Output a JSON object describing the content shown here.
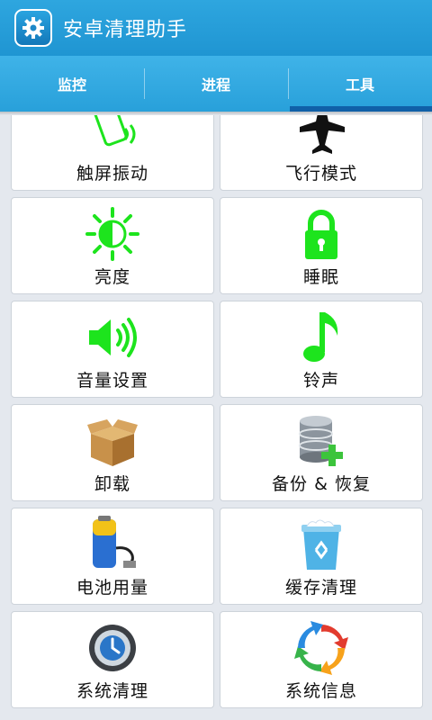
{
  "app": {
    "title": "安卓清理助手"
  },
  "tabs": [
    {
      "label": "监控"
    },
    {
      "label": "进程"
    },
    {
      "label": "工具"
    }
  ],
  "tools": [
    {
      "label": "触屏振动",
      "icon": "phone-vibrate-icon"
    },
    {
      "label": "飞行模式",
      "icon": "airplane-icon"
    },
    {
      "label": "亮度",
      "icon": "brightness-icon"
    },
    {
      "label": "睡眠",
      "icon": "lock-icon"
    },
    {
      "label": "音量设置",
      "icon": "speaker-icon"
    },
    {
      "label": "铃声",
      "icon": "music-note-icon"
    },
    {
      "label": "卸载",
      "icon": "box-icon"
    },
    {
      "label": "备份 & 恢复",
      "icon": "database-plus-icon"
    },
    {
      "label": "电池用量",
      "icon": "battery-icon"
    },
    {
      "label": "缓存清理",
      "icon": "recycle-bin-icon"
    },
    {
      "label": "系统清理",
      "icon": "clock-icon"
    },
    {
      "label": "系统信息",
      "icon": "refresh-icon"
    }
  ],
  "colors": {
    "accent": "#28a0da",
    "icon_green": "#1de41d",
    "selected_tab": "#1060a8"
  }
}
